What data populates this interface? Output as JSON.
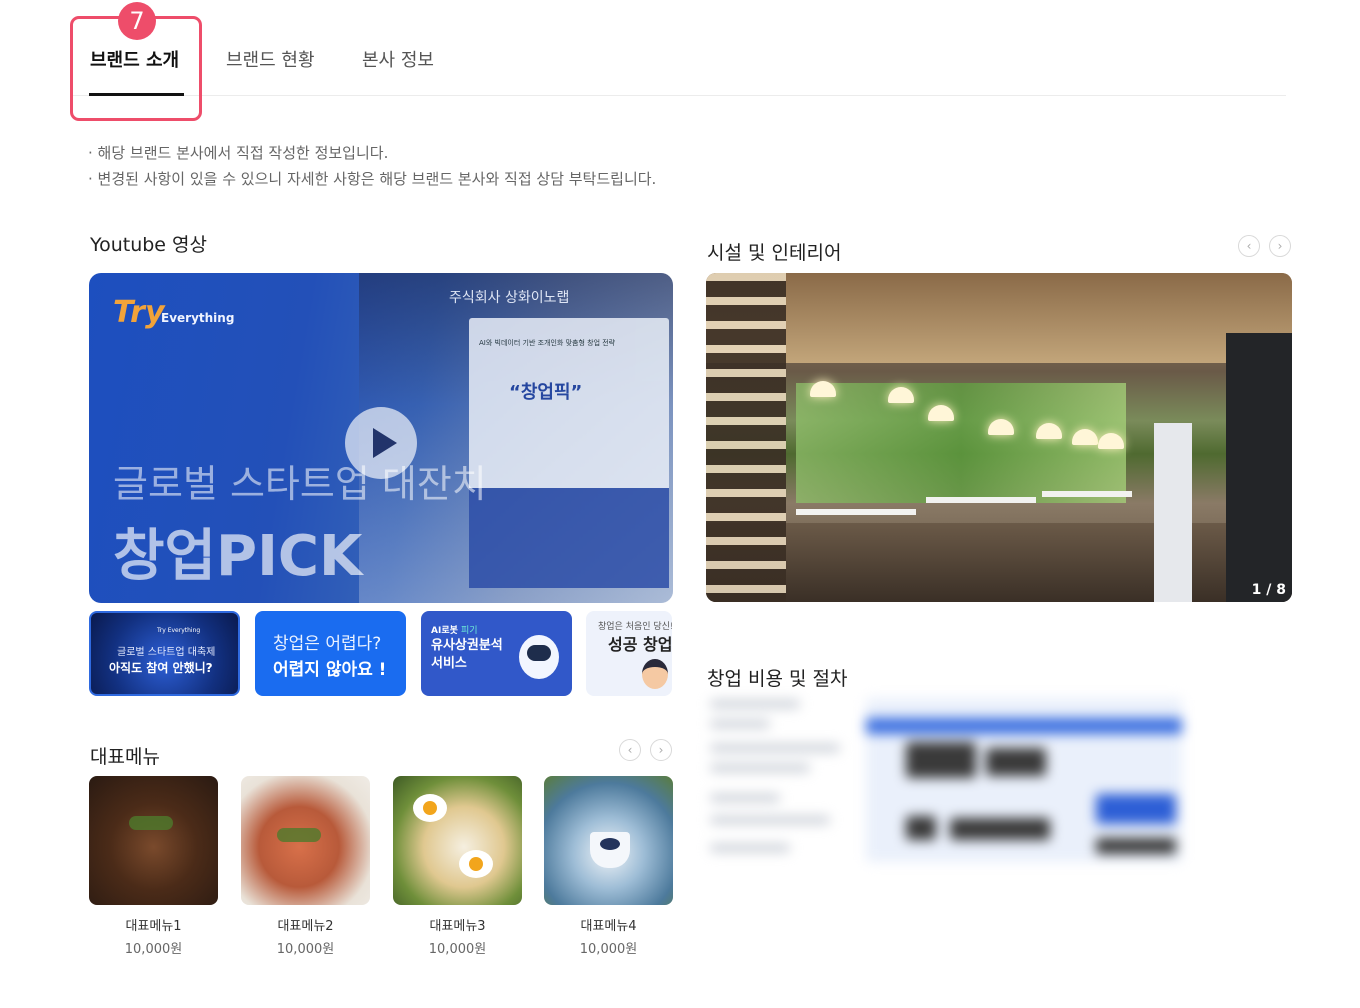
{
  "step_badge": "7",
  "tabs": [
    {
      "label": "브랜드 소개",
      "active": true
    },
    {
      "label": "브랜드 현황",
      "active": false
    },
    {
      "label": "본사 정보",
      "active": false
    }
  ],
  "notices": [
    "· 해당 브랜드 본사에서 직접 작성한 정보입니다.",
    "· 변경된 사항이 있을 수 있으니 자세한 사항은 해당 브랜드 본사와 직접 상담 부탁드립니다."
  ],
  "youtube": {
    "title": "Youtube 영상",
    "video": {
      "logo_try": "Try",
      "logo_everything": "Everything",
      "booth_name": "주식회사 상화이노랩",
      "panel_subtitle": "AI와 빅데이터 기반 조개인화 맞춤형 창업 전략",
      "panel_title": "“창업픽”",
      "headline": "글로벌 스타트업 대잔치",
      "bigtext": "창업PICK"
    },
    "thumbnails": [
      {
        "logo": "Try Everything",
        "line1": "글로벌 스타트업 대축제",
        "line2": "아직도 참여 안했니?"
      },
      {
        "line1": "창업은 어렵다?",
        "line2": "어렵지 않아요 !"
      },
      {
        "line1_prefix": "AI로봇 ",
        "line1_highlight": "피기",
        "line2": "유사상권분석",
        "line3": "서비스"
      },
      {
        "line1": "창업은 처음인 당신!",
        "line2": "성공 창업"
      }
    ]
  },
  "menu": {
    "title": "대표메뉴",
    "prev_icon": "‹",
    "next_icon": "›",
    "items": [
      {
        "name": "대표메뉴1",
        "price": "10,000원"
      },
      {
        "name": "대표메뉴2",
        "price": "10,000원"
      },
      {
        "name": "대표메뉴3",
        "price": "10,000원"
      },
      {
        "name": "대표메뉴4",
        "price": "10,000원"
      }
    ]
  },
  "interior": {
    "title": "시설 및 인테리어",
    "prev_icon": "‹",
    "next_icon": "›",
    "counter": "1 / 8"
  },
  "cost": {
    "title": "창업 비용 및 절차"
  }
}
